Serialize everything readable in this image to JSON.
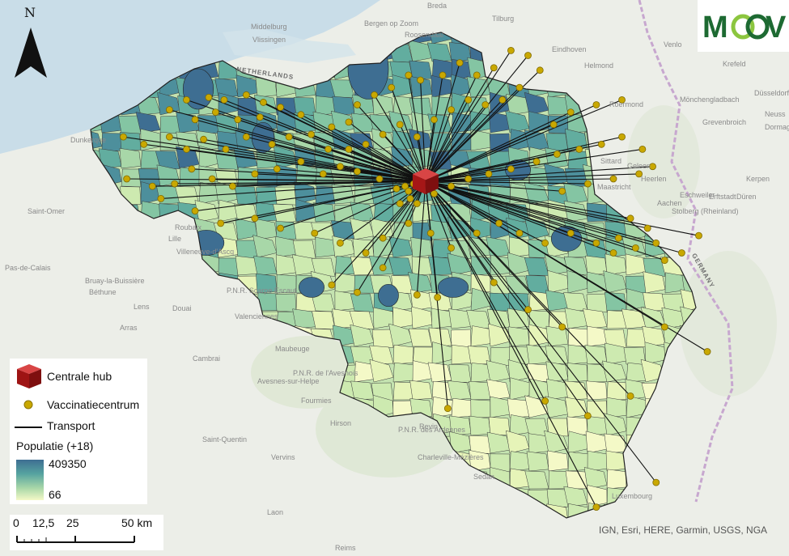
{
  "map": {
    "north_label": "N",
    "logo_text": "MOOV",
    "basemap_labels": {
      "countries": [
        "NETHERLANDS",
        "GERMANY"
      ],
      "cities": [
        "Middelburg",
        "Vlissingen",
        "Breda",
        "Tilburg",
        "Eindhoven",
        "Bergen op Zoom",
        "Roosendaal",
        "Helmond",
        "Roermond",
        "Venlo",
        "Krefeld",
        "Düsseldorf",
        "Mönchengladbach",
        "Neuss",
        "Grevenbroich",
        "Dormagen",
        "Sittard",
        "Geleen",
        "Heerlen",
        "Maastricht",
        "Aachen",
        "Düren",
        "Eschweiler",
        "Stolberg (Rheinland)",
        "Kerpen",
        "Erftstadt",
        "Dunkerque",
        "Saint-Omer",
        "Lille",
        "Roubaix",
        "Villeneuve-d'Ascq",
        "Béthune",
        "Lens",
        "Douai",
        "Arras",
        "Valenciennes",
        "Cambrai",
        "Bruay-la-Buissière",
        "Pas-de-Calais",
        "Saint-Quentin",
        "Laon",
        "Reims",
        "Charleville-Mézières",
        "Sedan",
        "Luxembourg",
        "Hirson",
        "Fourmies",
        "Avesnes-sur-Helpe",
        "Maubeuge",
        "Revin",
        "Vervins"
      ],
      "parks": [
        "P.N.R. Scarpe Escaut",
        "P.N.R. de l'Avesnois",
        "P.N.R. des Ardennes"
      ]
    },
    "attribution": "IGN, Esri, HERE, Garmin, USGS, NGA",
    "colors": {
      "hub": "#b81d1d",
      "center": "#c9a800",
      "transport": "#111111",
      "choropleth_low": "#f4f9c7",
      "choropleth_high": "#3e6e92",
      "water": "#c9dde8"
    },
    "hub": {
      "lon": 4.45,
      "lat": 50.87
    },
    "centers": [
      [
        2.95,
        51.16
      ],
      [
        3.05,
        51.2
      ],
      [
        3.18,
        51.21
      ],
      [
        3.27,
        51.2
      ],
      [
        3.4,
        51.22
      ],
      [
        3.5,
        51.19
      ],
      [
        3.1,
        51.12
      ],
      [
        3.22,
        51.15
      ],
      [
        3.35,
        51.12
      ],
      [
        3.48,
        51.13
      ],
      [
        3.6,
        51.17
      ],
      [
        3.72,
        51.14
      ],
      [
        2.68,
        51.05
      ],
      [
        2.8,
        51.02
      ],
      [
        2.95,
        51.05
      ],
      [
        3.05,
        51.0
      ],
      [
        3.15,
        51.04
      ],
      [
        3.28,
        51.0
      ],
      [
        3.4,
        51.05
      ],
      [
        3.55,
        51.02
      ],
      [
        3.65,
        51.05
      ],
      [
        3.78,
        51.06
      ],
      [
        3.9,
        51.09
      ],
      [
        4.0,
        51.11
      ],
      [
        4.05,
        51.18
      ],
      [
        4.15,
        51.22
      ],
      [
        4.25,
        51.25
      ],
      [
        4.35,
        51.3
      ],
      [
        4.42,
        51.28
      ],
      [
        4.55,
        51.3
      ],
      [
        4.65,
        51.35
      ],
      [
        4.75,
        51.3
      ],
      [
        4.85,
        51.33
      ],
      [
        4.95,
        51.4
      ],
      [
        5.05,
        51.38
      ],
      [
        5.12,
        51.32
      ],
      [
        5.0,
        51.25
      ],
      [
        4.9,
        51.2
      ],
      [
        4.8,
        51.18
      ],
      [
        4.7,
        51.2
      ],
      [
        4.6,
        51.16
      ],
      [
        4.5,
        51.12
      ],
      [
        4.4,
        51.05
      ],
      [
        4.3,
        51.1
      ],
      [
        4.2,
        51.06
      ],
      [
        4.1,
        51.02
      ],
      [
        4.0,
        51.0
      ],
      [
        3.88,
        51.0
      ],
      [
        2.7,
        50.88
      ],
      [
        2.85,
        50.85
      ],
      [
        2.98,
        50.86
      ],
      [
        3.08,
        50.92
      ],
      [
        3.2,
        50.88
      ],
      [
        3.32,
        50.85
      ],
      [
        3.45,
        50.9
      ],
      [
        3.58,
        50.92
      ],
      [
        3.72,
        50.95
      ],
      [
        3.85,
        50.9
      ],
      [
        3.95,
        50.93
      ],
      [
        4.05,
        50.91
      ],
      [
        4.18,
        50.88
      ],
      [
        4.28,
        50.84
      ],
      [
        4.33,
        50.85
      ],
      [
        4.35,
        50.83
      ],
      [
        4.38,
        50.86
      ],
      [
        4.36,
        50.8
      ],
      [
        4.3,
        50.78
      ],
      [
        4.4,
        50.78
      ],
      [
        4.5,
        50.82
      ],
      [
        4.6,
        50.85
      ],
      [
        4.7,
        50.88
      ],
      [
        4.82,
        50.9
      ],
      [
        4.95,
        50.92
      ],
      [
        5.1,
        50.95
      ],
      [
        5.22,
        50.98
      ],
      [
        5.35,
        51.0
      ],
      [
        5.48,
        51.02
      ],
      [
        5.6,
        51.05
      ],
      [
        5.72,
        51.0
      ],
      [
        5.78,
        50.93
      ],
      [
        5.7,
        50.9
      ],
      [
        5.55,
        50.88
      ],
      [
        5.4,
        50.86
      ],
      [
        5.25,
        50.83
      ],
      [
        5.6,
        51.2
      ],
      [
        5.45,
        51.18
      ],
      [
        5.3,
        51.15
      ],
      [
        5.2,
        51.1
      ],
      [
        2.9,
        50.8
      ],
      [
        3.1,
        50.75
      ],
      [
        3.25,
        50.7
      ],
      [
        3.45,
        50.72
      ],
      [
        3.6,
        50.68
      ],
      [
        3.8,
        50.66
      ],
      [
        3.95,
        50.62
      ],
      [
        4.1,
        50.58
      ],
      [
        4.2,
        50.64
      ],
      [
        4.35,
        50.7
      ],
      [
        4.48,
        50.66
      ],
      [
        4.6,
        50.6
      ],
      [
        4.75,
        50.66
      ],
      [
        4.88,
        50.7
      ],
      [
        5.0,
        50.66
      ],
      [
        5.15,
        50.62
      ],
      [
        5.3,
        50.66
      ],
      [
        5.45,
        50.62
      ],
      [
        5.58,
        50.64
      ],
      [
        5.68,
        50.6
      ],
      [
        5.8,
        50.62
      ],
      [
        5.95,
        50.58
      ],
      [
        6.05,
        50.65
      ],
      [
        5.85,
        50.55
      ],
      [
        5.55,
        50.58
      ],
      [
        5.75,
        50.68
      ],
      [
        5.65,
        50.72
      ],
      [
        3.9,
        50.45
      ],
      [
        4.05,
        50.42
      ],
      [
        4.4,
        50.41
      ],
      [
        4.52,
        50.4
      ],
      [
        4.2,
        50.52
      ],
      [
        4.85,
        50.46
      ],
      [
        5.05,
        50.35
      ],
      [
        5.25,
        50.28
      ],
      [
        5.85,
        50.28
      ],
      [
        6.1,
        50.18
      ],
      [
        4.58,
        49.95
      ],
      [
        5.15,
        49.98
      ],
      [
        5.4,
        49.92
      ],
      [
        5.65,
        50.0
      ],
      [
        5.8,
        49.65
      ],
      [
        5.45,
        49.55
      ]
    ]
  }
}
